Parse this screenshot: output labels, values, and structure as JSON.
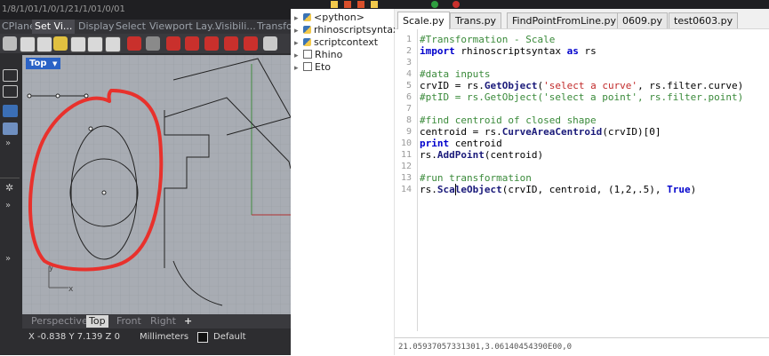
{
  "rhino": {
    "top_fragment": "1/8/1/01/1/0/1/21/1/01/0/01",
    "menu_tabs": [
      "CPlanes",
      "Set Vi...",
      "Display",
      "Select",
      "Viewport Lay...",
      "Visibili...",
      "Transfo"
    ],
    "active_menu_tab": "Set Vi...",
    "viewport_label": "Top",
    "axis_y": "y",
    "axis_x": "x",
    "view_tabs": [
      "Perspective",
      "Top",
      "Front",
      "Right",
      "+"
    ],
    "active_view_tab": "Top",
    "status": {
      "coordinates": "X -0.838 Y 7.139 Z 0",
      "units": "Millimeters",
      "layer": "Default"
    }
  },
  "editor": {
    "tree": [
      {
        "label": "<python>",
        "caret": "▸",
        "icon": "python-icon"
      },
      {
        "label": "rhinoscriptsyntax",
        "caret": "▸",
        "icon": "python-icon"
      },
      {
        "label": "scriptcontext",
        "caret": "▸",
        "icon": "python-icon"
      },
      {
        "label": "Rhino",
        "caret": "▸",
        "icon": "package-icon"
      },
      {
        "label": "Eto",
        "caret": "▸",
        "icon": "package-icon"
      }
    ],
    "tabs": [
      "Scale.py",
      "Trans.py",
      "FindPointFromLine.py",
      "0609.py",
      "test0603.py"
    ],
    "active_tab": "Scale.py",
    "line_numbers": [
      "1",
      "2",
      "3",
      "4",
      "5",
      "6",
      "7",
      "8",
      "9",
      "10",
      "11",
      "12",
      "13",
      "14"
    ],
    "code": [
      "#Transformation - Scale",
      "import rhinoscriptsyntax as rs",
      "",
      "#data inputs",
      "crvID = rs.GetObject('select a curve', rs.filter.curve)",
      "#ptID = rs.GetObject('select a point', rs.filter.point)",
      "",
      "#find centroid of closed shape",
      "centroid = rs.CurveAreaCentroid(crvID)[0]",
      "print centroid",
      "rs.AddPoint(centroid)",
      "",
      "#run transformation",
      "rs.ScaleObject(crvID, centroid, (1,2,.5), True)"
    ],
    "output_fragment": "21.05937057331301,3.06140454390E00,0"
  },
  "colors": {
    "annotation_red": "#e8312c",
    "viewport_bg": "#a8acb3",
    "rhino_dark": "#2d2d30",
    "comment_green": "#3a8a3a",
    "keyword_blue": "#0000cc",
    "string_red": "#c12a2a",
    "viewport_label_blue": "#2b63c6"
  }
}
